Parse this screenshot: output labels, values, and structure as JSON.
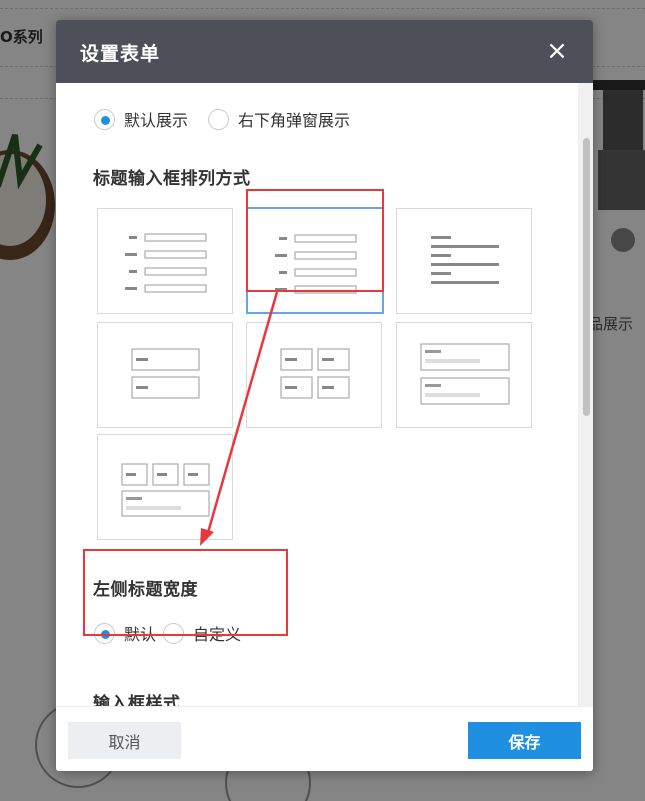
{
  "background": {
    "series_label": "O系列",
    "product_label": "品展示"
  },
  "modal": {
    "title": "设置表单",
    "close_symbol": "×",
    "display_mode": {
      "options": [
        "默认展示",
        "右下角弹窗展示"
      ],
      "selected": 0
    },
    "layout_section": {
      "title": "标题输入框排列方式",
      "options_count": 7,
      "selected_index": 1
    },
    "label_width_section": {
      "title": "左侧标题宽度",
      "options": [
        "默认",
        "自定义"
      ],
      "selected": 0
    },
    "input_style_section": {
      "title": "输入框样式"
    },
    "footer": {
      "cancel_label": "取消",
      "save_label": "保存"
    }
  },
  "colors": {
    "header_bg": "#4d5059",
    "primary": "#1e8fe1",
    "annotation": "#e8383c",
    "selected_border": "#6aa4e8"
  }
}
